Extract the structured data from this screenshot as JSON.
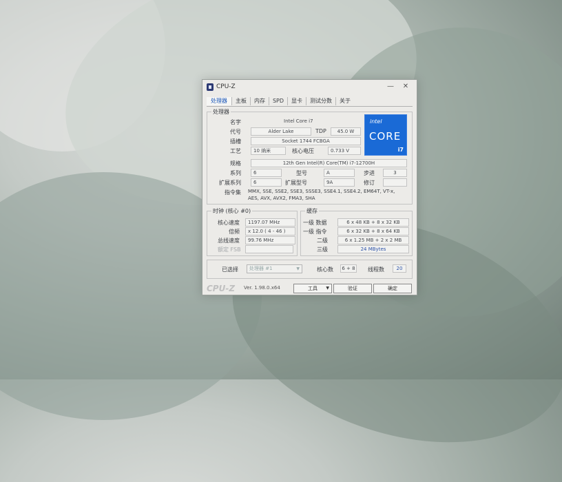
{
  "window": {
    "title": "CPU-Z",
    "minimize": "—",
    "close": "✕"
  },
  "tabs": [
    "处理器",
    "主板",
    "内存",
    "SPD",
    "显卡",
    "测试分数",
    "关于"
  ],
  "processor": {
    "group_title": "处理器",
    "name_label": "名字",
    "name": "Intel Core i7",
    "codename_label": "代号",
    "codename": "Alder Lake",
    "tdp_label": "TDP",
    "tdp": "45.0 W",
    "package_label": "插槽",
    "package": "Socket 1744 FCBGA",
    "tech_label": "工艺",
    "tech": "10 纳米",
    "voltage_label": "核心电压",
    "voltage": "0.733 V",
    "spec_label": "规格",
    "spec": "12th Gen Intel(R) Core(TM) i7-12700H",
    "family_label": "系列",
    "family": "6",
    "model_label": "型号",
    "model": "A",
    "stepping_label": "步进",
    "stepping": "3",
    "ext_family_label": "扩展系列",
    "ext_family": "6",
    "ext_model_label": "扩展型号",
    "ext_model": "9A",
    "revision_label": "修订",
    "revision": "",
    "instructions_label": "指令集",
    "instructions_1": "MMX, SSE, SSE2, SSE3, SSSE3, SSE4.1, SSE4.2, EM64T, VT-x,",
    "instructions_2": "AES, AVX, AVX2, FMA3, SHA"
  },
  "badge": {
    "brand": "intel",
    "line": "CORE",
    "tier": "i7"
  },
  "clocks": {
    "group_title": "时钟 (核心 #0)",
    "core_speed_label": "核心速度",
    "core_speed": "1197.07 MHz",
    "multiplier_label": "倍频",
    "multiplier": "x 12.0 ( 4 - 46 )",
    "bus_speed_label": "总线速度",
    "bus_speed": "99.76 MHz",
    "fsb_label": "额定 FSB"
  },
  "cache": {
    "group_title": "缓存",
    "l1d_label": "一级 数据",
    "l1d": "6 x 48 KB + 8 x 32 KB",
    "l1i_label": "一级 指令",
    "l1i": "6 x 32 KB + 8 x 64 KB",
    "l2_label": "二级",
    "l2": "6 x 1.25 MB + 2 x 2 MB",
    "l3_label": "三级",
    "l3": "24 MBytes"
  },
  "selection": {
    "selected_label": "已选择",
    "processor": "处理器 #1",
    "cores_label": "核心数",
    "cores": "6 + 8",
    "threads_label": "线程数",
    "threads": "20"
  },
  "footer": {
    "logo": "CPU-Z",
    "version": "Ver. 1.98.0.x64",
    "tools": "工具",
    "validate": "验证",
    "ok": "确定"
  }
}
